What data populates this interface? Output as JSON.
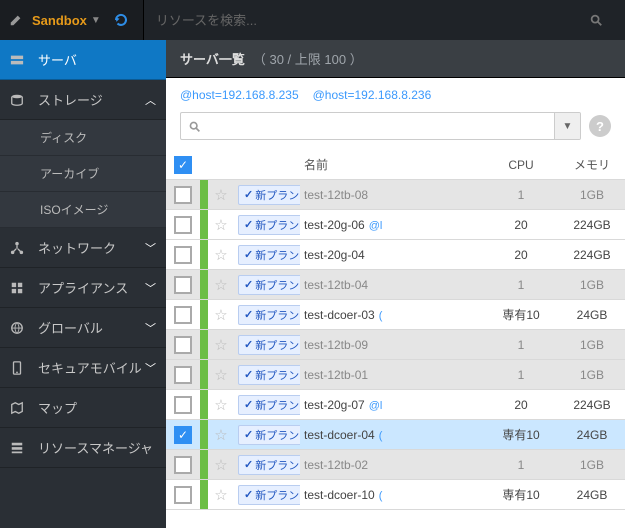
{
  "topbar": {
    "brand": "Sandbox",
    "search_placeholder": "リソースを検索..."
  },
  "sidebar": {
    "items": [
      {
        "icon": "server",
        "label": "サーバ",
        "active": true
      },
      {
        "icon": "storage",
        "label": "ストレージ",
        "expand": "up",
        "children": [
          {
            "label": "ディスク"
          },
          {
            "label": "アーカイブ"
          },
          {
            "label": "ISOイメージ"
          }
        ]
      },
      {
        "icon": "network",
        "label": "ネットワーク",
        "expand": "down"
      },
      {
        "icon": "appliance",
        "label": "アプライアンス",
        "expand": "down"
      },
      {
        "icon": "global",
        "label": "グローバル",
        "expand": "down"
      },
      {
        "icon": "mobile",
        "label": "セキュアモバイル",
        "expand": "down"
      },
      {
        "icon": "map",
        "label": "マップ"
      },
      {
        "icon": "resource",
        "label": "リソースマネージャ"
      }
    ]
  },
  "header": {
    "title": "サーバ一覧",
    "count": "（ 30 / 上限 100 ）"
  },
  "filters": [
    "@host=192.168.8.235",
    "@host=192.168.8.236"
  ],
  "table": {
    "cols": {
      "name": "名前",
      "cpu": "CPU",
      "mem": "メモリ"
    },
    "plan_label": "新プラン",
    "rows": [
      {
        "name": "test-12tb-08",
        "cpu": "1",
        "mem": "1GB",
        "grey": true,
        "status": "green",
        "extra": ""
      },
      {
        "name": "test-20g-06",
        "cpu": "20",
        "mem": "224GB",
        "status": "green",
        "extra": "@l"
      },
      {
        "name": "test-20g-04",
        "cpu": "20",
        "mem": "224GB",
        "status": "green",
        "extra": ""
      },
      {
        "name": "test-12tb-04",
        "cpu": "1",
        "mem": "1GB",
        "grey": true,
        "status": "green",
        "extra": ""
      },
      {
        "name": "test-dcoer-03",
        "cpu": "専有10",
        "mem": "24GB",
        "status": "green",
        "extra": "("
      },
      {
        "name": "test-12tb-09",
        "cpu": "1",
        "mem": "1GB",
        "grey": true,
        "status": "green",
        "extra": ""
      },
      {
        "name": "test-12tb-01",
        "cpu": "1",
        "mem": "1GB",
        "grey": true,
        "status": "green",
        "extra": ""
      },
      {
        "name": "test-20g-07",
        "cpu": "20",
        "mem": "224GB",
        "status": "green",
        "extra": "@l"
      },
      {
        "name": "test-dcoer-04",
        "cpu": "専有10",
        "mem": "24GB",
        "checked": true,
        "status": "green",
        "extra": "("
      },
      {
        "name": "test-12tb-02",
        "cpu": "1",
        "mem": "1GB",
        "grey": true,
        "status": "green",
        "extra": ""
      },
      {
        "name": "test-dcoer-10",
        "cpu": "専有10",
        "mem": "24GB",
        "status": "green",
        "extra": "("
      }
    ]
  }
}
